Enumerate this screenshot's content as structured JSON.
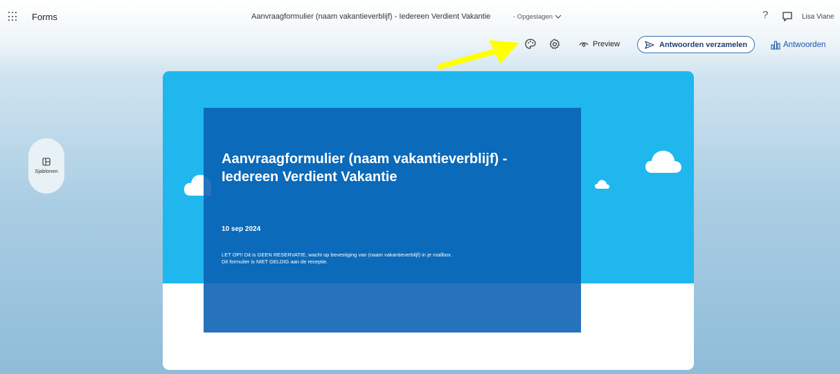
{
  "topbar": {
    "app_name": "Forms",
    "doc_title": "Aanvraagformulier (naam vakantieverblijf) - Iedereen Verdient Vakantie",
    "doc_status": "-  Opgeslagen",
    "help_glyph": "?",
    "user_name": "Lisa Viane"
  },
  "toolbar": {
    "preview_label": "Preview",
    "collect_label": "Antwoorden verzamelen",
    "responses_label": "Antwoorden"
  },
  "sidebar": {
    "templates_label": "Sjablonen"
  },
  "form": {
    "title": "Aanvraagformulier (naam vakantieverblijf) - Iedereen Verdient Vakantie",
    "date": "10 sep 2024",
    "note_line1": "LET OP!!  Dit is GEEN RESERVATIE, wacht op bevestiging van (naam vakantieverblijf) in je mailbox.",
    "note_line2": "Dit formulier is NIET GELDIG aan de receptie."
  },
  "colors": {
    "banner": "#20b7ee",
    "header_panel": "#0860b2",
    "accent": "#1a54a8",
    "arrow": "#ffff00"
  },
  "icons": [
    "waffle-icon",
    "chevron-down-icon",
    "help-icon",
    "feedback-icon",
    "theme-palette-icon",
    "gear-icon",
    "eye-icon",
    "send-icon",
    "bar-chart-icon",
    "template-grid-icon",
    "cloud-icon"
  ]
}
